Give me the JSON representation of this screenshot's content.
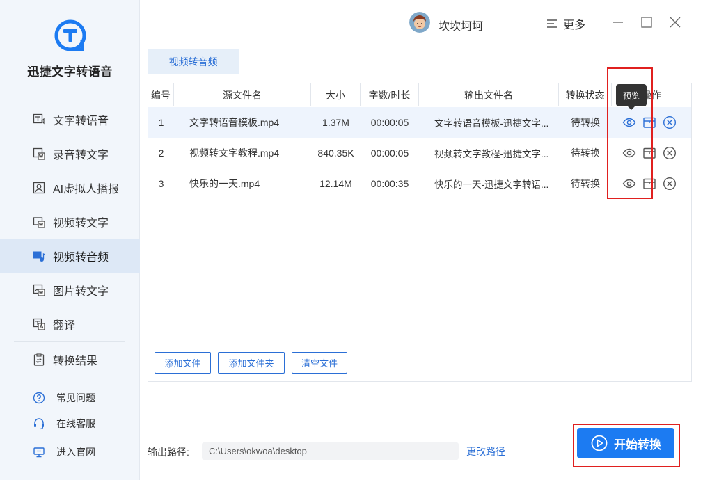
{
  "app": {
    "name": "迅捷文字转语音",
    "brand_color": "#1c7bf2"
  },
  "sidebar": {
    "items": [
      {
        "label": "文字转语音",
        "icon": "text-to-speech-icon",
        "active": false
      },
      {
        "label": "录音转文字",
        "icon": "audio-to-text-icon",
        "active": false
      },
      {
        "label": "AI虚拟人播报",
        "icon": "ai-avatar-icon",
        "active": false
      },
      {
        "label": "视频转文字",
        "icon": "video-to-text-icon",
        "active": false
      },
      {
        "label": "视频转音频",
        "icon": "video-to-audio-icon",
        "active": true
      },
      {
        "label": "图片转文字",
        "icon": "image-to-text-icon",
        "active": false
      },
      {
        "label": "翻译",
        "icon": "translate-icon",
        "active": false
      },
      {
        "label": "转换结果",
        "icon": "results-icon",
        "active": false
      }
    ],
    "help": [
      {
        "label": "常见问题",
        "icon": "question-icon"
      },
      {
        "label": "在线客服",
        "icon": "headset-icon"
      },
      {
        "label": "进入官网",
        "icon": "monitor-icon"
      }
    ]
  },
  "header": {
    "username": "坎坎坷坷",
    "more_label": "更多"
  },
  "main": {
    "tab_label": "视频转音频",
    "columns": [
      "编号",
      "源文件名",
      "大小",
      "字数/时长",
      "输出文件名",
      "转换状态",
      "操作"
    ],
    "rows": [
      {
        "idx": "1",
        "src": "文字转语音模板.mp4",
        "size": "1.37M",
        "duration": "00:00:05",
        "out": "文字转语音模板-迅捷文字...",
        "status": "待转换"
      },
      {
        "idx": "2",
        "src": "视频转文字教程.mp4",
        "size": "840.35K",
        "duration": "00:00:05",
        "out": "视频转文字教程-迅捷文字...",
        "status": "待转换"
      },
      {
        "idx": "3",
        "src": "快乐的一天.mp4",
        "size": "12.14M",
        "duration": "00:00:35",
        "out": "快乐的一天-迅捷文字转语...",
        "status": "待转换"
      }
    ],
    "tooltip": "预览",
    "buttons": {
      "add_file": "添加文件",
      "add_folder": "添加文件夹",
      "clear_files": "清空文件"
    }
  },
  "footer": {
    "output_label": "输出路径:",
    "output_path": "C:\\Users\\okwoa\\desktop",
    "change_path": "更改路径",
    "start_label": "开始转换"
  }
}
